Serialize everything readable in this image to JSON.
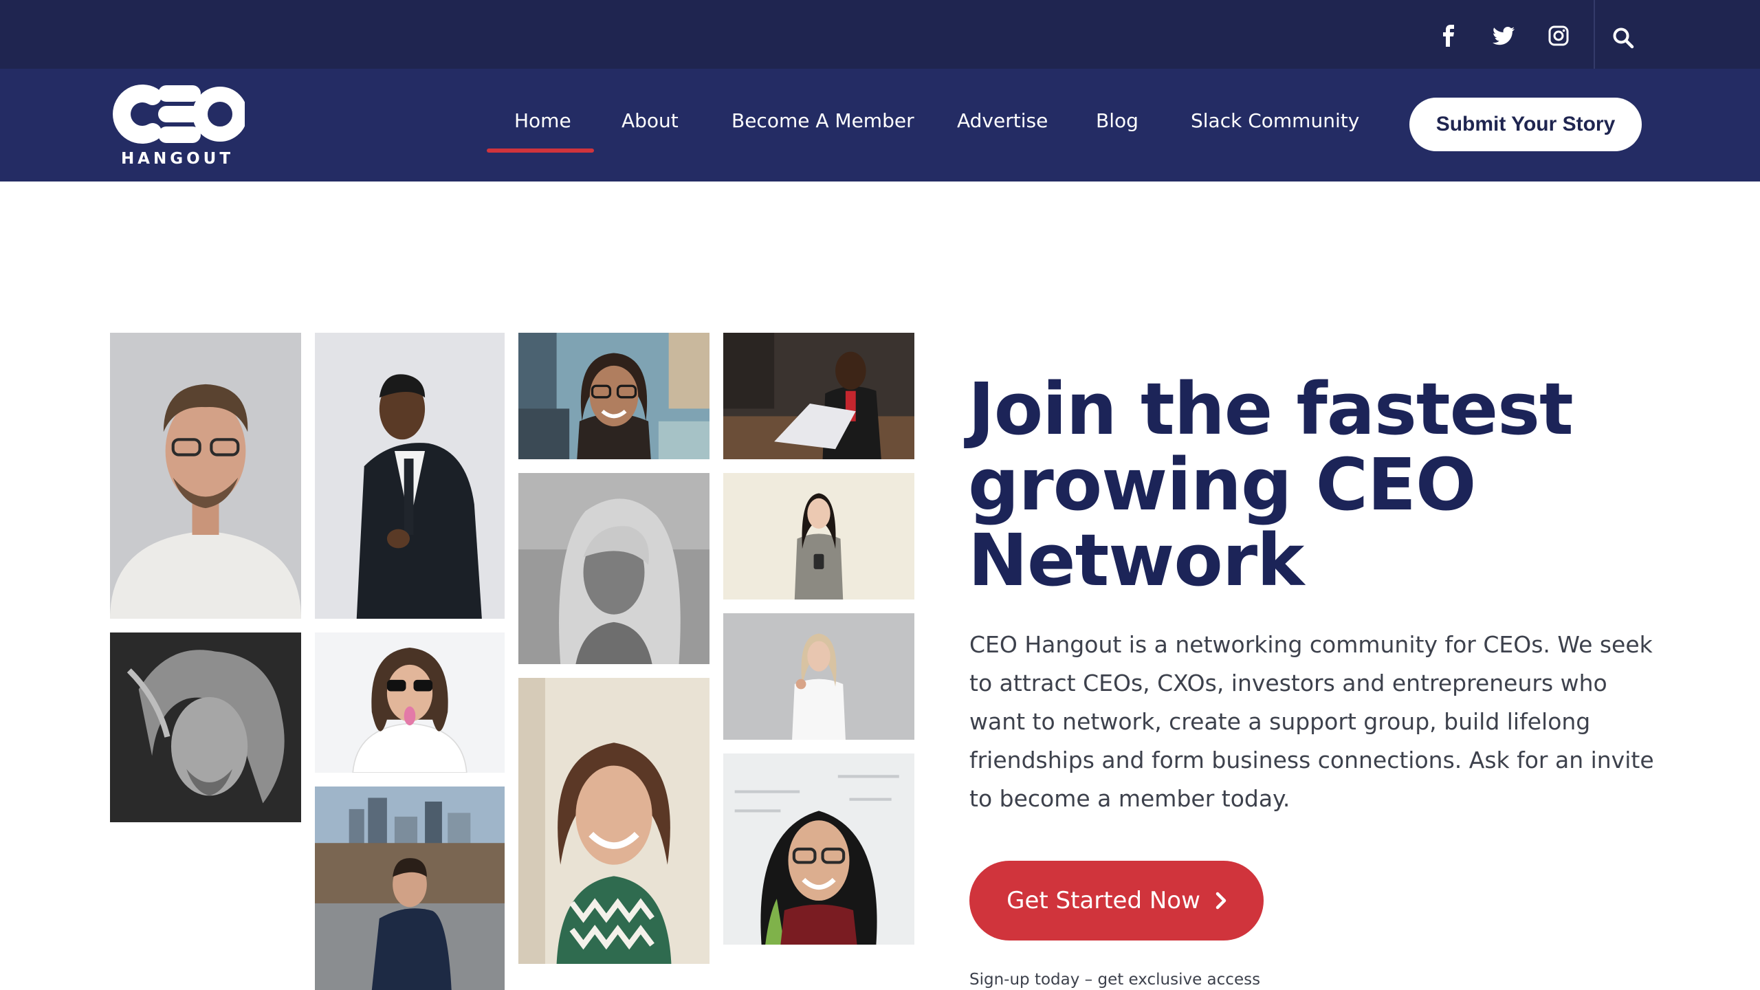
{
  "colors": {
    "topbar_bg": "#1f2550",
    "navbar_bg": "#242c64",
    "accent_red": "#d0343c",
    "heading_navy": "#1c2458",
    "body_text": "#3d414c"
  },
  "topbar": {
    "social_icons": [
      "facebook-icon",
      "twitter-icon",
      "instagram-icon"
    ],
    "search_icon": "search-icon"
  },
  "header": {
    "logo": {
      "mark": "CEO",
      "subtitle": "HANGOUT"
    },
    "nav": [
      {
        "label": "Home",
        "active": true
      },
      {
        "label": "About"
      },
      {
        "label": "Become A Member"
      },
      {
        "label": "Advertise"
      },
      {
        "label": "Blog"
      },
      {
        "label": "Slack Community"
      }
    ],
    "cta_label": "Submit Your Story"
  },
  "hero": {
    "title": "Join the fastest growing CEO Network",
    "description": "CEO Hangout is a networking community for CEOs. We seek to attract CEOs, CXOs, investors and entrepreneurs who want to network, create a support group, build lifelong friendships and form business connections. Ask for an invite to become a member today.",
    "cta_label": "Get Started Now",
    "cta_icon": "chevron-right-icon",
    "note": "Sign-up today – get exclusive access"
  }
}
